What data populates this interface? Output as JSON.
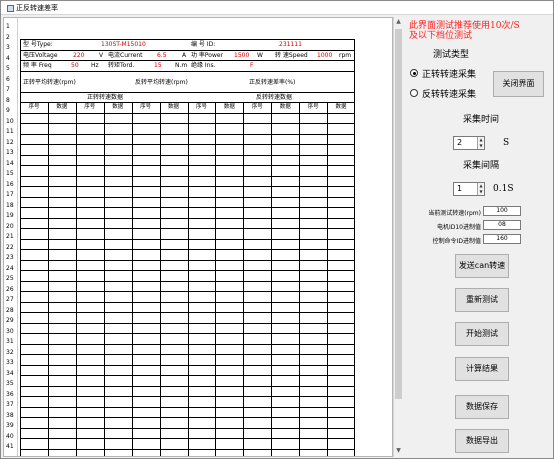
{
  "window": {
    "title": "正反转速差率"
  },
  "sheet": {
    "row_numbers": [
      "1",
      "2",
      "3",
      "4",
      "5",
      "6",
      "7",
      "8",
      "9",
      "10",
      "11",
      "12",
      "13",
      "14",
      "15",
      "16",
      "17",
      "18",
      "19",
      "20",
      "21",
      "22",
      "23",
      "24",
      "25",
      "26",
      "27",
      "28",
      "29",
      "30",
      "31",
      "32",
      "33",
      "34",
      "35",
      "36",
      "37",
      "38",
      "39",
      "40",
      "41"
    ],
    "model_label": "型 号Type:",
    "model_value": "130ST-M15010",
    "id_label": "编 号 ID:",
    "id_value": "231111",
    "voltage_label": "电压Voltage",
    "voltage_value": "220",
    "voltage_unit": "V",
    "current_label": "电流Current",
    "current_value": "6.5",
    "current_unit": "A",
    "power_label": "功 率Power",
    "power_value": "1500",
    "power_unit": "W",
    "speed_label": "转 速Speed",
    "speed_value": "1000",
    "speed_unit": "rpm",
    "freq_label": "频 率 Freq",
    "freq_value": "50",
    "freq_unit": "Hz",
    "torque_label": "转矩Tord.",
    "torque_value": "15",
    "torque_unit": "N.m",
    "ins_label": "绝缘 Ins.",
    "ins_value": "F",
    "fwd_avg_label": "正转平均转速(rpm)",
    "rev_avg_label": "反转平均转速(rpm)",
    "diff_label": "正反转速差率(%)",
    "fwd_data_title": "正转转速数据",
    "rev_data_title": "反转转速数据",
    "col_seq": "序号",
    "col_data": "数据"
  },
  "panel": {
    "notice_line1": "此界面测试推荐使用10次/S",
    "notice_line2": "及以下档位测试",
    "test_type_title": "测试类型",
    "radio_forward": "正转转速采集",
    "radio_reverse": "反转转速采集",
    "close_button": "关闭界面",
    "collect_time_title": "采集时间",
    "collect_time_value": "2",
    "collect_time_unit": "S",
    "collect_interval_title": "采集间隔",
    "collect_interval_value": "1",
    "collect_interval_unit": "0.1S",
    "current_speed_label": "当前测试转速(rpm)",
    "current_speed_value": "100",
    "motor_id_label": "电机ID10进制值",
    "motor_id_value": "08",
    "ctrl_cmd_label": "控制命令ID进制值",
    "ctrl_cmd_value": "160",
    "btn_send_can": "发送can转速",
    "btn_retest": "重新测试",
    "btn_start": "开始测试",
    "btn_calc": "计算结果",
    "btn_save": "数据保存",
    "btn_export": "数据导出"
  },
  "colors": {
    "notice": "#ff2020",
    "value_red": "#d00000"
  }
}
